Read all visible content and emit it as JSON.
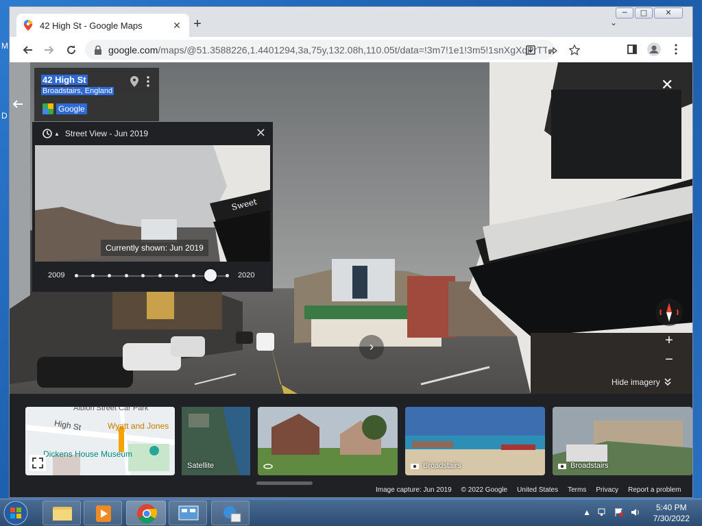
{
  "desktop": {
    "labels": [
      "M",
      "D"
    ]
  },
  "window": {
    "minimize": "─",
    "maximize": "□",
    "close": "✕"
  },
  "tab": {
    "title": "42 High St - Google Maps",
    "close": "✕",
    "new_tab": "+",
    "tab_search": "⌄"
  },
  "toolbar": {
    "url_host": "google.com",
    "url_path": "/maps/@51.3588226,1.4401294,3a,75y,132.08h,110.05t/data=!3m7!1e1!3m5!1snXgXqPrTTj..."
  },
  "place": {
    "address": "42 High St",
    "city": "Broadstairs, England",
    "provider": "Google"
  },
  "timeline": {
    "title": "Street View - Jun 2019",
    "tooltip": "Currently shown: Jun 2019",
    "start_year": "2009",
    "end_year": "2020",
    "tick_count": 10,
    "selected_index": 8
  },
  "controls": {
    "close": "✕",
    "zoom_in": "+",
    "zoom_out": "−",
    "hide_imagery": "Hide imagery",
    "next": "›"
  },
  "filmstrip": {
    "map_card": {
      "street": "High St",
      "street2": "Albion Street Car Park",
      "poi1": "Wyatt and Jones",
      "poi2": "Dickens House Museum"
    },
    "cards": [
      {
        "label": "Satellite"
      },
      {
        "label": ""
      },
      {
        "label": "Broadstairs"
      },
      {
        "label": "Broadstairs"
      }
    ]
  },
  "footer": [
    "Image capture: Jun 2019",
    "© 2022 Google",
    "United States",
    "Terms",
    "Privacy",
    "Report a problem"
  ],
  "taskbar": {
    "time": "5:40 PM",
    "date": "7/30/2022"
  },
  "colors": {
    "accent": "#2d6ad6",
    "panel": "#202124"
  }
}
